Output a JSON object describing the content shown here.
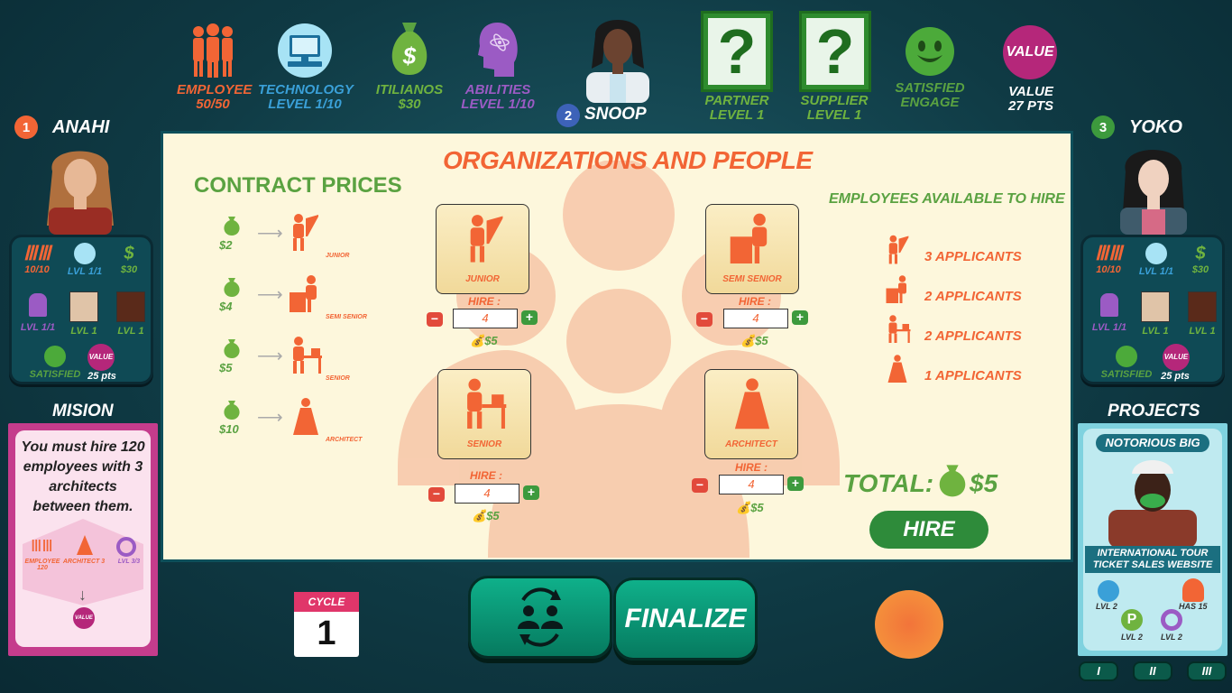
{
  "top_stats": {
    "employee": {
      "label": "EMPLOYEE",
      "value": "50/50"
    },
    "technology": {
      "label": "TECHNOLOGY",
      "value": "LEVEL  1/10"
    },
    "itilianos": {
      "label": "ITILIANOS",
      "value": "$30"
    },
    "abilities": {
      "label": "ABILITIES",
      "value": "LEVEL  1/10"
    },
    "partner": {
      "label": "PARTNER",
      "value": "LEVEL 1"
    },
    "supplier": {
      "label": "SUPPLIER",
      "value": "LEVEL 1"
    },
    "satisfied": {
      "label": "SATISFIED",
      "value": "ENGAGE"
    },
    "value": {
      "badge": "VALUE",
      "label": "VALUE",
      "value": "27 PTS"
    }
  },
  "current_player": {
    "number": "2",
    "name": "SNOOP"
  },
  "players": [
    {
      "number": "1",
      "name": "ANAHI",
      "employees": "10/10",
      "tech": "LVL 1/1",
      "money": "$30",
      "abilities": "LVL 1/1",
      "partner": "LVL 1",
      "supplier": "LVL 1",
      "satisfied": "SATISFIED",
      "value_badge": "VALUE",
      "points": "25 pts"
    },
    {
      "number": "3",
      "name": "YOKO",
      "employees": "10/10",
      "tech": "LVL 1/1",
      "money": "$30",
      "abilities": "LVL 1/1",
      "partner": "LVL 1",
      "supplier": "LVL 1",
      "satisfied": "SATISFIED",
      "value_badge": "VALUE",
      "points": "25 pts"
    }
  ],
  "board": {
    "title": "ORGANIZATIONS AND PEOPLE",
    "contract_prices_title": "CONTRACT PRICES",
    "contract_prices": [
      {
        "price": "$2",
        "role": "JUNIOR"
      },
      {
        "price": "$4",
        "role": "SEMI SENIOR"
      },
      {
        "price": "$5",
        "role": "SENIOR"
      },
      {
        "price": "$10",
        "role": "ARCHITECT"
      }
    ],
    "hire_cards": [
      {
        "role": "JUNIOR",
        "hire_label": "HIRE :",
        "quantity": "4",
        "cost": "$5"
      },
      {
        "role": "SEMI SENIOR",
        "hire_label": "HIRE :",
        "quantity": "4",
        "cost": "$5"
      },
      {
        "role": "SENIOR",
        "hire_label": "HIRE :",
        "quantity": "4",
        "cost": "$5"
      },
      {
        "role": "ARCHITECT",
        "hire_label": "HIRE :",
        "quantity": "4",
        "cost": "$5"
      }
    ],
    "available_title": "EMPLOYEES AVAILABLE TO HIRE",
    "available": [
      {
        "role": "JUNIOR",
        "text": "3  APPLICANTS"
      },
      {
        "role": "SEMI SENIOR",
        "text": "2 APPLICANTS"
      },
      {
        "role": "SENIOR",
        "text": "2 APPLICANTS"
      },
      {
        "role": "ARCHITECT",
        "text": "1 APPLICANTS"
      }
    ],
    "total_label": "TOTAL:",
    "total_value": "$5",
    "hire_button": "HIRE"
  },
  "mission": {
    "header": "MISION",
    "text": "You must hire 120 employees with 3 architects between them.",
    "icon_labels": [
      "EMPLOYEE 120",
      "ARCHITECT 3",
      "LVL 3/3"
    ],
    "value_badge": "VALUE"
  },
  "projects": {
    "header": "PROJECTS",
    "card_title": "NOTORIOUS BIG",
    "card_subtitle": "INTERNATIONAL TOUR TICKET SALES WEBSITE",
    "requirements": [
      "LVL 2",
      "HAS 15",
      "LVL 2",
      "LVL 2"
    ],
    "tabs": [
      "I",
      "II",
      "III"
    ]
  },
  "cycle": {
    "label": "CYCLE",
    "value": "1"
  },
  "finalize_label": "FINALIZE",
  "colors": {
    "orange": "#f26535",
    "green": "#5aa241",
    "blue": "#3aa0d8",
    "purple": "#9b5bc4",
    "teal_button": "#0fb08a"
  }
}
